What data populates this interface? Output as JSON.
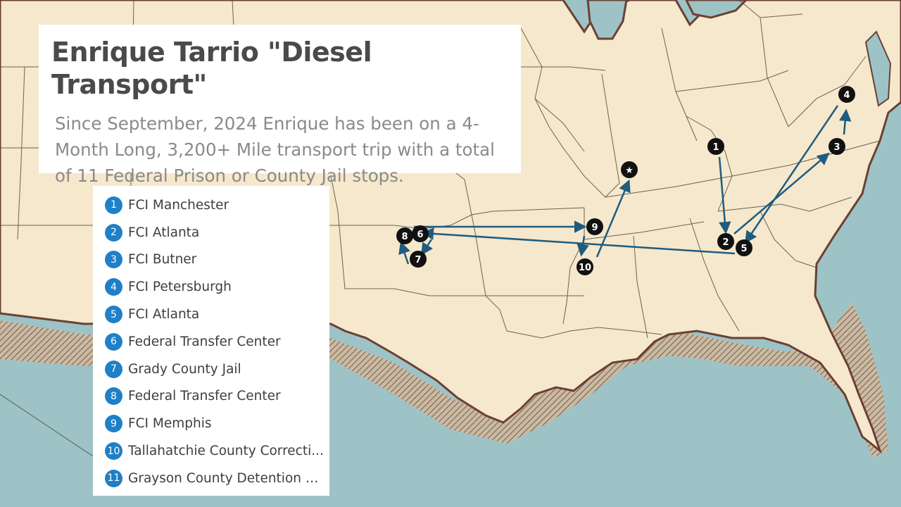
{
  "title": "Enrique Tarrio \"Diesel Transport\"",
  "subtitle": "Since September, 2024 Enrique has been on a 4-Month Long, 3,200+ Mile transport trip with a total of 11 Federal Prison or County Jail stops.",
  "legend": [
    {
      "num": "1",
      "label": "FCI Manchester"
    },
    {
      "num": "2",
      "label": "FCI Atlanta"
    },
    {
      "num": "3",
      "label": "FCI Butner"
    },
    {
      "num": "4",
      "label": "FCI Petersburgh"
    },
    {
      "num": "5",
      "label": "FCI Atlanta"
    },
    {
      "num": "6",
      "label": "Federal Transfer Center"
    },
    {
      "num": "7",
      "label": "Grady County Jail"
    },
    {
      "num": "8",
      "label": "Federal Transfer Center"
    },
    {
      "num": "9",
      "label": "FCI Memphis"
    },
    {
      "num": "10",
      "label": "Tallahatchie County Correcti..."
    },
    {
      "num": "11",
      "label": "Grayson County Detention C..."
    }
  ],
  "markers": [
    "1",
    "2",
    "3",
    "4",
    "5",
    "6",
    "7",
    "8",
    "9",
    "10",
    "★"
  ],
  "colors": {
    "land": "#f6e8cc",
    "water": "#9dc3c7",
    "coast": "#6b4035",
    "route": "#1f5c80",
    "marker": "#111111",
    "legend_badge": "#1f7fc7"
  }
}
